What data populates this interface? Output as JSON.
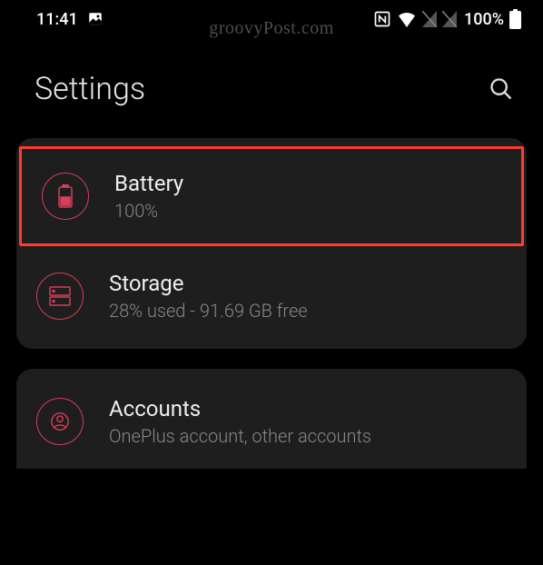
{
  "status": {
    "time": "11:41",
    "battery_pct": "100%"
  },
  "watermark": "groovyPost.com",
  "header": {
    "title": "Settings"
  },
  "items": {
    "battery": {
      "title": "Battery",
      "subtitle": "100%"
    },
    "storage": {
      "title": "Storage",
      "subtitle": "28% used - 91.69 GB free"
    },
    "accounts": {
      "title": "Accounts",
      "subtitle": "OnePlus account, other accounts"
    }
  },
  "colors": {
    "accent": "#d63e5a",
    "highlight": "#ff3b30",
    "card": "#1e1e1e",
    "bg": "#000000"
  }
}
